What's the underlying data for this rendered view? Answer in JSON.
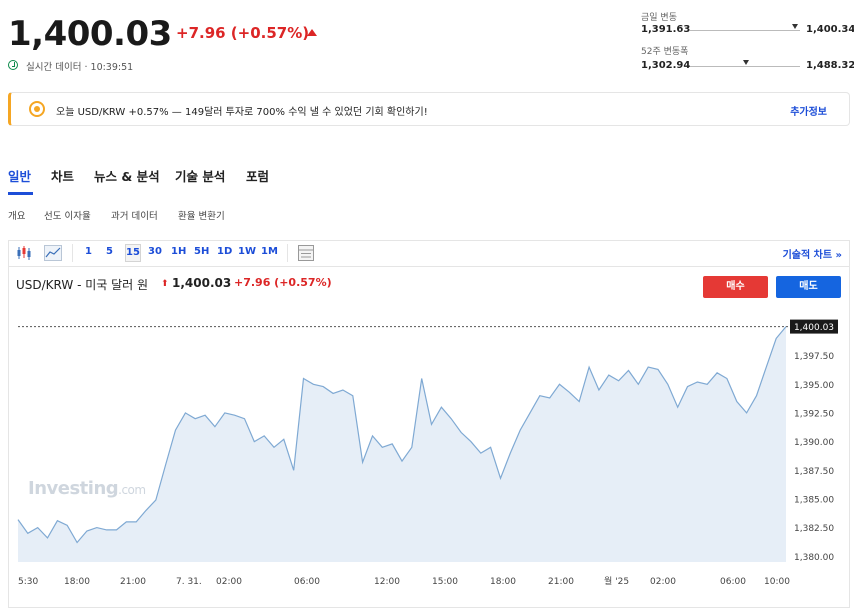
{
  "quote": {
    "price": "1,400.03",
    "change": "+7.96 (+0.57%)",
    "realtime": "실시간 데이터 · 10:39:51"
  },
  "ranges": {
    "day_label": "금일 변동",
    "day_low": "1,391.63",
    "day_high": "1,400.34",
    "week52_label": "52주 변동폭",
    "week52_low": "1,302.94",
    "week52_high": "1,488.32"
  },
  "banner": {
    "text": "오늘 USD/KRW +0.57% — 149달러 투자로 700% 수익 낼 수 있었던 기회 확인하기!",
    "link": "추가정보"
  },
  "tabs": [
    "일반",
    "차트",
    "뉴스 & 분석",
    "기술 분석",
    "포럼"
  ],
  "subtabs": [
    "개요",
    "선도 이자율",
    "과거 데이터",
    "환율 변환기"
  ],
  "toolbar": {
    "timeframes": [
      "1",
      "5",
      "15",
      "30",
      "1H",
      "5H",
      "1D",
      "1W",
      "1M"
    ],
    "active": "15",
    "tech_link": "기술적 차트 »"
  },
  "chart_header": {
    "title": "USD/KRW - 미국 달러 원",
    "price": "1,400.03",
    "change": "+7.96 (+0.57%)",
    "buy": "매수",
    "sell": "매도",
    "watermark": "Investing",
    "watermark_suffix": ".com"
  },
  "chart_data": {
    "type": "area",
    "y_ticks": [
      "1,397.50",
      "1,395.00",
      "1,392.50",
      "1,390.00",
      "1,387.50",
      "1,385.00",
      "1,382.50",
      "1,380.00"
    ],
    "x_ticks": [
      "5:30",
      "18:00",
      "21:00",
      "7. 31.",
      "02:00",
      "06:00",
      "12:00",
      "15:00",
      "18:00",
      "21:00",
      "월 '25",
      "02:00",
      "06:00",
      "10:00"
    ],
    "last_price_label": "1,400.03",
    "ylim": [
      1379.5,
      1402
    ],
    "values": [
      1383.2,
      1382.0,
      1382.5,
      1381.6,
      1383.1,
      1382.7,
      1381.2,
      1382.2,
      1382.5,
      1382.3,
      1382.3,
      1383.0,
      1383.0,
      1384.0,
      1384.9,
      1388.0,
      1391.0,
      1392.5,
      1392.0,
      1392.3,
      1391.3,
      1392.5,
      1392.3,
      1392.0,
      1390.0,
      1390.5,
      1389.5,
      1390.2,
      1387.5,
      1395.5,
      1395.0,
      1394.8,
      1394.2,
      1394.5,
      1394.0,
      1388.2,
      1390.5,
      1389.5,
      1389.8,
      1388.3,
      1389.5,
      1395.5,
      1391.5,
      1393.0,
      1392.0,
      1390.8,
      1390.0,
      1389.0,
      1389.5,
      1386.8,
      1389.0,
      1391.0,
      1392.5,
      1394.0,
      1393.8,
      1395.0,
      1394.3,
      1393.5,
      1396.5,
      1394.5,
      1395.8,
      1395.3,
      1396.2,
      1395.0,
      1396.5,
      1396.3,
      1395.0,
      1393.0,
      1394.8,
      1395.2,
      1395.0,
      1396.0,
      1395.5,
      1393.5,
      1392.5,
      1394.0,
      1396.5,
      1399.0,
      1400.03
    ]
  }
}
